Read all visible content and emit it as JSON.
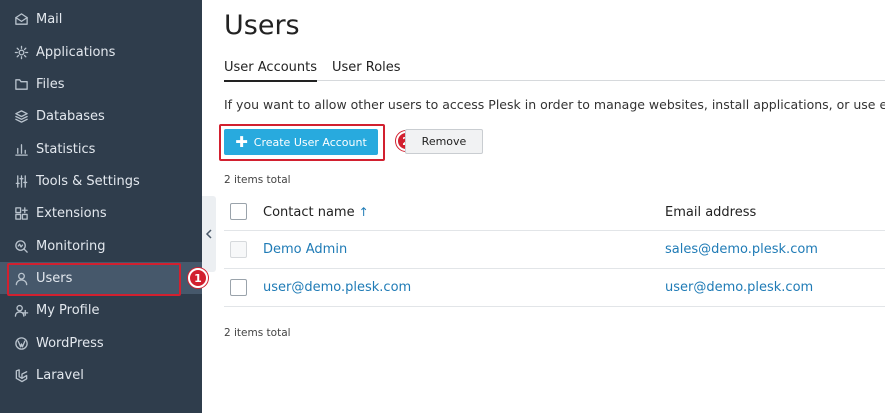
{
  "sidebar": {
    "items": [
      {
        "label": "Mail",
        "icon": "mail-icon"
      },
      {
        "label": "Applications",
        "icon": "gear-icon"
      },
      {
        "label": "Files",
        "icon": "folder-icon"
      },
      {
        "label": "Databases",
        "icon": "database-icon"
      },
      {
        "label": "Statistics",
        "icon": "bar-chart-icon"
      },
      {
        "label": "Tools & Settings",
        "icon": "sliders-icon"
      },
      {
        "label": "Extensions",
        "icon": "extensions-icon"
      },
      {
        "label": "Monitoring",
        "icon": "monitoring-icon"
      },
      {
        "label": "Users",
        "icon": "user-icon",
        "active": true
      },
      {
        "label": "My Profile",
        "icon": "profile-icon"
      },
      {
        "label": "WordPress",
        "icon": "wordpress-icon"
      },
      {
        "label": "Laravel",
        "icon": "laravel-icon"
      }
    ]
  },
  "callouts": {
    "one": "1",
    "two": "2"
  },
  "colors": {
    "callout": "#d2202f",
    "accent": "#28aade",
    "sidebar": "#2f3d4c",
    "link": "#1f7bb6"
  },
  "page": {
    "title": "Users",
    "tabs": [
      {
        "label": "User Accounts",
        "active": true
      },
      {
        "label": "User Roles"
      }
    ],
    "hint": "If you want to allow other users to access Plesk in order to manage websites, install applications, or use email services",
    "toolbar": {
      "create_label": "Create User Account",
      "remove_label": "Remove"
    },
    "total_top": "2 items total",
    "total_bottom": "2 items total",
    "table": {
      "headers": {
        "name": "Contact name",
        "sort_arrow": "↑",
        "email": "Email address"
      },
      "rows": [
        {
          "name": "Demo Admin",
          "email": "sales@demo.plesk.com",
          "selectable": false
        },
        {
          "name": "user@demo.plesk.com",
          "email": "user@demo.plesk.com",
          "selectable": true
        }
      ]
    }
  }
}
